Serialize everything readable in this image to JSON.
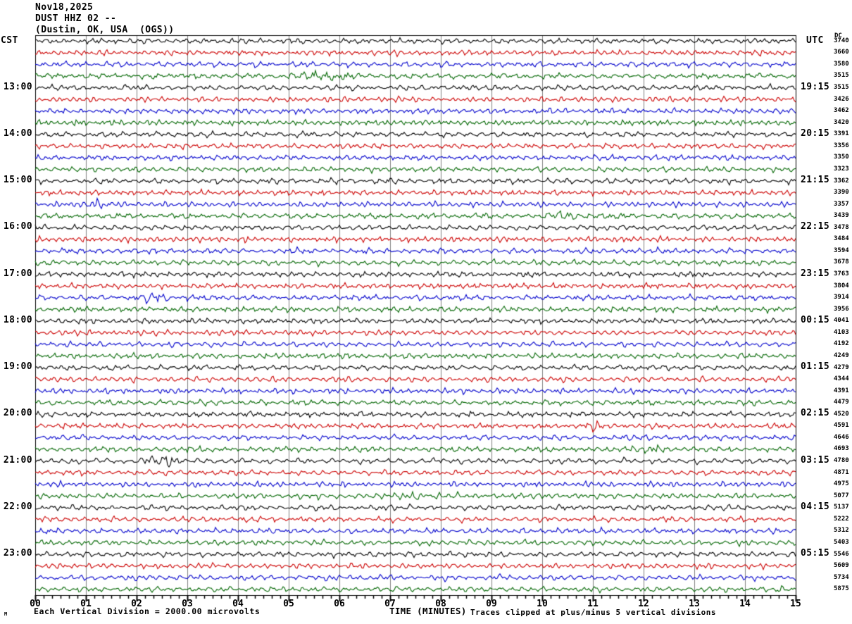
{
  "header": {
    "date": "Nov18,2025",
    "station_line": "DUST HHZ 02 --",
    "location_line": "(Dustin, OK, USA  (OGS))"
  },
  "axes": {
    "left_label": "CST",
    "right_label": "UTC",
    "dc_header": "DC",
    "x_title": "TIME (MINUTES)"
  },
  "footer": {
    "scale_note": "Each Vertical Division = 2000.00 microvolts",
    "clip_note": "Traces clipped at plus/minus 5 vertical divisions",
    "corner_glyph": "M"
  },
  "chart_data": {
    "type": "line",
    "subtype": "helicorder_seismogram",
    "title": "DUST HHZ 02 -- (Dustin, OK, USA (OGS)) Nov18,2025",
    "xlabel": "TIME (MINUTES)",
    "x_range_minutes": [
      0,
      15
    ],
    "x_tick_labels": [
      "00",
      "01",
      "02",
      "03",
      "04",
      "05",
      "06",
      "07",
      "08",
      "09",
      "10",
      "11",
      "12",
      "13",
      "14",
      "15"
    ],
    "minor_ticks_per_minute": 6,
    "num_rows": 48,
    "row_duration_minutes": 15,
    "start_time_cst": "12:00",
    "grid": true,
    "grid_color": "#808080",
    "trace_color_cycle": [
      "#000000",
      "#cc0000",
      "#0000cc",
      "#006600"
    ],
    "clip_divisions": 5,
    "microvolts_per_division": 2000.0,
    "cst_ticks": [
      {
        "row": 4,
        "label": "13:00"
      },
      {
        "row": 8,
        "label": "14:00"
      },
      {
        "row": 12,
        "label": "15:00"
      },
      {
        "row": 16,
        "label": "16:00"
      },
      {
        "row": 20,
        "label": "17:00"
      },
      {
        "row": 24,
        "label": "18:00"
      },
      {
        "row": 28,
        "label": "19:00"
      },
      {
        "row": 32,
        "label": "20:00"
      },
      {
        "row": 36,
        "label": "21:00"
      },
      {
        "row": 40,
        "label": "22:00"
      },
      {
        "row": 44,
        "label": "23:00"
      }
    ],
    "utc_ticks": [
      {
        "row": 4,
        "label": "19:15"
      },
      {
        "row": 8,
        "label": "20:15"
      },
      {
        "row": 12,
        "label": "21:15"
      },
      {
        "row": 16,
        "label": "22:15"
      },
      {
        "row": 20,
        "label": "23:15"
      },
      {
        "row": 24,
        "label": "00:15"
      },
      {
        "row": 28,
        "label": "01:15"
      },
      {
        "row": 32,
        "label": "02:15"
      },
      {
        "row": 36,
        "label": "03:15"
      },
      {
        "row": 40,
        "label": "04:15"
      },
      {
        "row": 44,
        "label": "05:15"
      }
    ],
    "dc_values": [
      3740,
      3660,
      3580,
      3515,
      3515,
      3426,
      3462,
      3420,
      3391,
      3356,
      3350,
      3323,
      3362,
      3390,
      3357,
      3439,
      3478,
      3484,
      3594,
      3678,
      3763,
      3804,
      3914,
      3956,
      4041,
      4103,
      4192,
      4249,
      4279,
      4344,
      4391,
      4479,
      4520,
      4591,
      4646,
      4693,
      4780,
      4871,
      4975,
      5077,
      5137,
      5222,
      5312,
      5403,
      5546,
      5609,
      5734,
      5875
    ],
    "events": [
      {
        "row": 3,
        "minute": 5.7,
        "dur": 1.0,
        "amp": 2.2
      },
      {
        "row": 14,
        "minute": 1.2,
        "dur": 0.6,
        "amp": 2.4
      },
      {
        "row": 15,
        "minute": 10.5,
        "dur": 0.7,
        "amp": 1.9
      },
      {
        "row": 22,
        "minute": 2.4,
        "dur": 0.8,
        "amp": 2.2
      },
      {
        "row": 33,
        "minute": 11.0,
        "dur": 0.4,
        "amp": 2.3
      },
      {
        "row": 35,
        "minute": 12.2,
        "dur": 0.6,
        "amp": 1.9
      },
      {
        "row": 36,
        "minute": 2.5,
        "dur": 0.6,
        "amp": 2.9
      },
      {
        "row": 39,
        "minute": 7.6,
        "dur": 0.9,
        "amp": 2.1
      }
    ]
  }
}
